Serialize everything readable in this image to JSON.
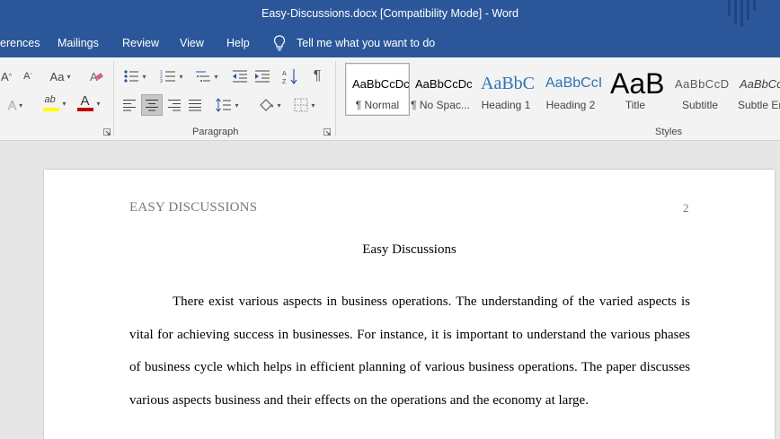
{
  "window": {
    "title": "Easy-Discussions.docx [Compatibility Mode]  -  Word",
    "accent": "#2b579a"
  },
  "menu": {
    "tabs": [
      "erences",
      "Mailings",
      "Review",
      "View",
      "Help"
    ],
    "tell_me": "Tell me what you want to do",
    "tell_me_icon": "lightbulb-icon"
  },
  "ribbon": {
    "font_group": {
      "buttons": [
        {
          "name": "increase-font-size-icon",
          "text": "A^"
        },
        {
          "name": "decrease-font-size-icon",
          "text": "Aˇ"
        },
        {
          "name": "change-case-button",
          "text": "Aa"
        },
        {
          "name": "clear-formatting-icon",
          "text": ""
        },
        {
          "name": "text-effects-icon",
          "text": "A"
        },
        {
          "name": "highlight-color-icon",
          "text": "ab"
        },
        {
          "name": "font-color-icon",
          "text": "A"
        }
      ],
      "highlight_color": "#ffff00",
      "font_color": "#c00000"
    },
    "paragraph_group": {
      "label": "Paragraph",
      "buttons": [
        "bullets-icon",
        "numbering-icon",
        "multilevel-list-icon",
        "decrease-indent-icon",
        "increase-indent-icon",
        "sort-icon",
        "show-formatting-marks-icon",
        "align-left-icon",
        "center-icon",
        "align-right-icon",
        "justify-icon",
        "line-spacing-icon",
        "shading-icon",
        "borders-icon"
      ],
      "selected": "center-icon"
    },
    "styles_group": {
      "label": "Styles",
      "items": [
        {
          "preview": "AaBbCcDc",
          "name": "¶ Normal",
          "selected": true
        },
        {
          "preview": "AaBbCcDc",
          "name": "¶ No Spac..."
        },
        {
          "preview": "AaBbC",
          "name": "Heading 1",
          "color": "#2e74b5"
        },
        {
          "preview": "AaBbCcI",
          "name": "Heading 2",
          "color": "#2e74b5"
        },
        {
          "preview": "AaB",
          "name": "Title"
        },
        {
          "preview": "AaBbCcD",
          "name": "Subtitle",
          "color": "#5a5a5a"
        },
        {
          "preview": "AaBbCc",
          "name": "Subtle Em"
        }
      ]
    }
  },
  "document": {
    "header": "EASY DISCUSSIONS",
    "page_number": "2",
    "title": "Easy Discussions",
    "paragraph": "There exist various aspects in business operations. The understanding of the varied aspects is vital for achieving success in businesses. For instance, it is important to understand the various phases of business cycle which helps in efficient planning of various business operations. The paper discusses various aspects business and their effects on the operations and the economy at large."
  }
}
